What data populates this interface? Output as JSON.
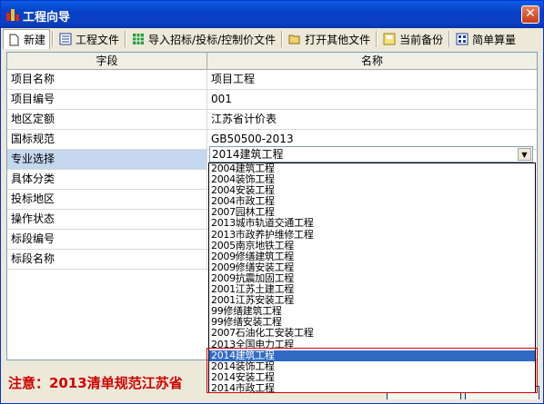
{
  "window": {
    "title": "工程向导",
    "close_glyph": "✕"
  },
  "toolbar": {
    "items": [
      {
        "label": "新建",
        "icon": "new-file-icon"
      },
      {
        "label": "工程文件",
        "icon": "list-icon"
      },
      {
        "label": "导入招标/投标/控制价文件",
        "icon": "import-grid-icon"
      },
      {
        "label": "打开其他文件",
        "icon": "folder-open-icon"
      },
      {
        "label": "当前备份",
        "icon": "backup-icon"
      },
      {
        "label": "简单算量",
        "icon": "calc-icon"
      }
    ]
  },
  "grid": {
    "headers": [
      "字段",
      "名称"
    ],
    "rows": [
      {
        "field": "项目名称",
        "value": "项目工程"
      },
      {
        "field": "项目编号",
        "value": "001"
      },
      {
        "field": "地区定额",
        "value": "江苏省计价表"
      },
      {
        "field": "国标规范",
        "value": "GB50500-2013"
      },
      {
        "field": "专业选择",
        "value": ""
      },
      {
        "field": "具体分类",
        "value": ""
      },
      {
        "field": "投标地区",
        "value": ""
      },
      {
        "field": "操作状态",
        "value": ""
      },
      {
        "field": "标段编号",
        "value": ""
      },
      {
        "field": "标段名称",
        "value": ""
      }
    ]
  },
  "combo": {
    "selected": "2014建筑工程",
    "arrow": "▼"
  },
  "dropdown": {
    "options": [
      "2004建筑工程",
      "2004装饰工程",
      "2004安装工程",
      "2004市政工程",
      "2007园林工程",
      "2013城市轨道交通工程",
      "2013市政养护维修工程",
      "2005南京地铁工程",
      "2009修缮建筑工程",
      "2009修缮安装工程",
      "2009抗震加固工程",
      "2001江苏土建工程",
      "2001江苏安装工程",
      "99修缮建筑工程",
      "99修缮安装工程",
      "2007石油化工安装工程",
      "2013全国电力工程",
      "2014建筑工程",
      "2014装饰工程",
      "2014安装工程",
      "2014市政工程"
    ],
    "highlighted_index": 17
  },
  "notice": "注意：2013清单规范江苏省"
}
